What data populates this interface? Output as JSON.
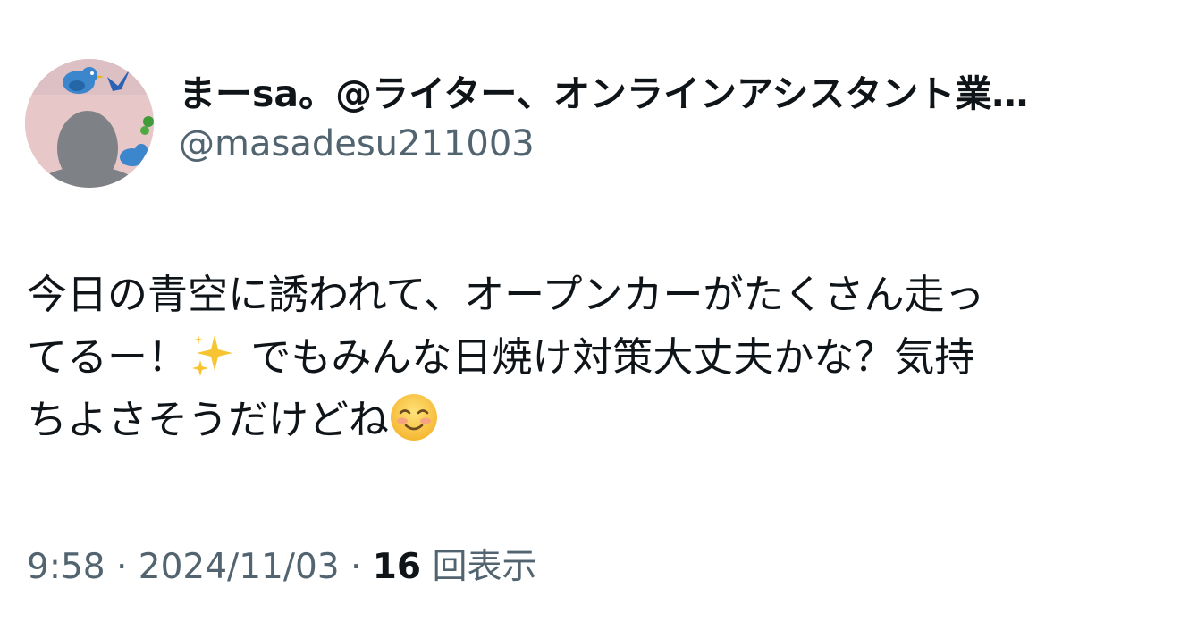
{
  "author": {
    "display_name": "まーsa。@ライター、オンラインアシスタント業…",
    "handle": "@masadesu211003"
  },
  "tweet": {
    "line1": "今日の青空に誘われて、オープンカーがたくさん走っ",
    "line2a": "てるー！",
    "line2b": " でもみんな日焼け対策大丈夫かな？気持",
    "line3": "ちよさそうだけどね",
    "emoji_sparkles": "sparkles-icon",
    "emoji_smile": "smiling-face-icon"
  },
  "meta": {
    "time": "9:58",
    "sep1": " · ",
    "date": "2024/11/03",
    "sep2": " · ",
    "views_count": "16",
    "views_label": " 回表示"
  },
  "colors": {
    "text": "#0f1419",
    "secondary": "#536471",
    "avatar_bg": "#e7c7c8",
    "bird_blue": "#3b86cc"
  }
}
